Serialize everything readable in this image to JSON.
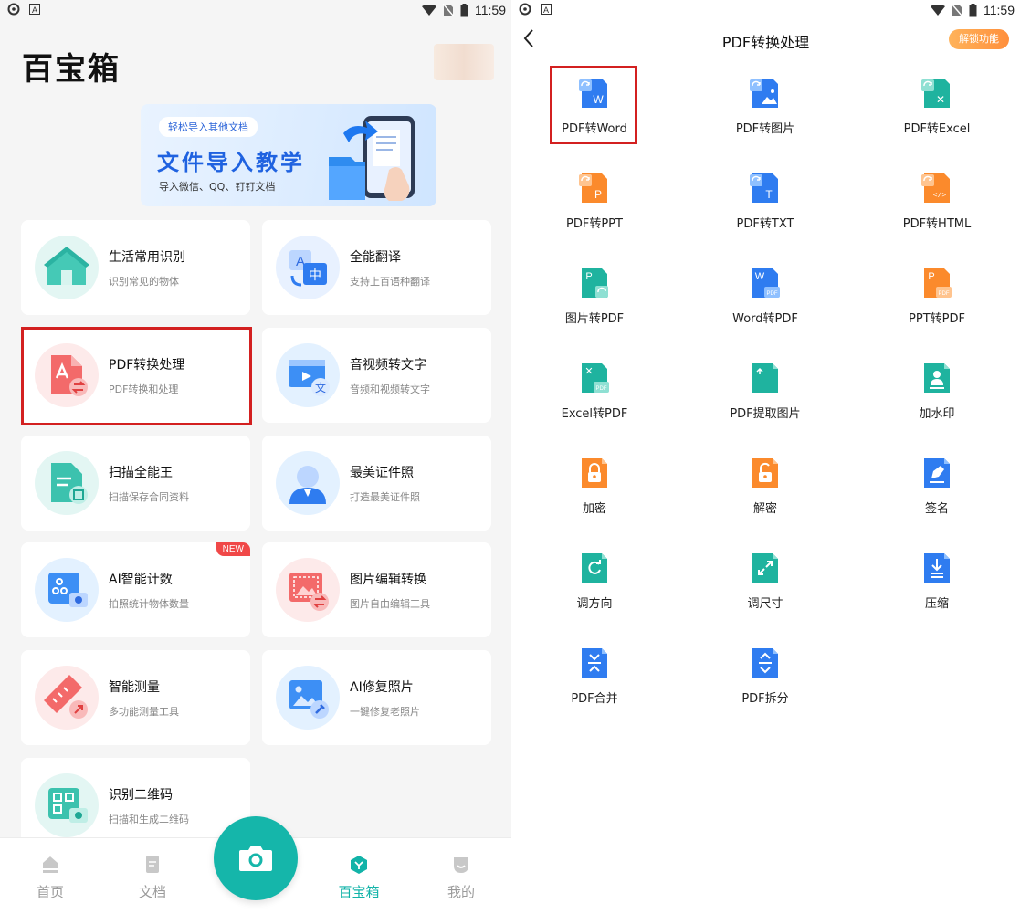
{
  "status_bar": {
    "time": "11:59"
  },
  "left": {
    "title": "百宝箱",
    "banner": {
      "tag": "轻松导入其他文档",
      "title": "文件导入教学",
      "subtitle": "导入微信、QQ、钉钉文档"
    },
    "cards": [
      {
        "title": "生活常用识别",
        "subtitle": "识别常见的物体",
        "icon": "house-icon"
      },
      {
        "title": "全能翻译",
        "subtitle": "支持上百语种翻译",
        "icon": "translate-icon"
      },
      {
        "title": "PDF转换处理",
        "subtitle": "PDF转换和处理",
        "icon": "pdf-convert-icon"
      },
      {
        "title": "音视频转文字",
        "subtitle": "音频和视频转文字",
        "icon": "video-text-icon"
      },
      {
        "title": "扫描全能王",
        "subtitle": "扫描保存合同资料",
        "icon": "scan-document-icon"
      },
      {
        "title": "最美证件照",
        "subtitle": "打造最美证件照",
        "icon": "id-photo-icon"
      },
      {
        "title": "AI智能计数",
        "subtitle": "拍照统计物体数量",
        "icon": "ai-count-icon",
        "badge": "NEW"
      },
      {
        "title": "图片编辑转换",
        "subtitle": "图片自由编辑工具",
        "icon": "image-edit-icon"
      },
      {
        "title": "智能测量",
        "subtitle": "多功能测量工具",
        "icon": "ruler-icon"
      },
      {
        "title": "AI修复照片",
        "subtitle": "一键修复老照片",
        "icon": "photo-repair-icon"
      },
      {
        "title": "识别二维码",
        "subtitle": "扫描和生成二维码",
        "icon": "qr-code-icon"
      }
    ],
    "nav": [
      {
        "label": "首页",
        "icon": "home-icon"
      },
      {
        "label": "文档",
        "icon": "document-icon"
      },
      {
        "label": "百宝箱",
        "icon": "toolbox-icon",
        "active": true
      },
      {
        "label": "我的",
        "icon": "profile-icon"
      }
    ]
  },
  "right": {
    "title": "PDF转换处理",
    "unlock_label": "解锁功能",
    "tools": [
      {
        "label": "PDF转Word",
        "icon": "pdf-to-word-icon"
      },
      {
        "label": "PDF转图片",
        "icon": "pdf-to-image-icon"
      },
      {
        "label": "PDF转Excel",
        "icon": "pdf-to-excel-icon"
      },
      {
        "label": "PDF转PPT",
        "icon": "pdf-to-ppt-icon"
      },
      {
        "label": "PDF转TXT",
        "icon": "pdf-to-txt-icon"
      },
      {
        "label": "PDF转HTML",
        "icon": "pdf-to-html-icon"
      },
      {
        "label": "图片转PDF",
        "icon": "image-to-pdf-icon"
      },
      {
        "label": "Word转PDF",
        "icon": "word-to-pdf-icon"
      },
      {
        "label": "PPT转PDF",
        "icon": "ppt-to-pdf-icon"
      },
      {
        "label": "Excel转PDF",
        "icon": "excel-to-pdf-icon"
      },
      {
        "label": "PDF提取图片",
        "icon": "pdf-extract-image-icon"
      },
      {
        "label": "加水印",
        "icon": "watermark-icon"
      },
      {
        "label": "加密",
        "icon": "encrypt-lock-icon"
      },
      {
        "label": "解密",
        "icon": "decrypt-unlock-icon"
      },
      {
        "label": "签名",
        "icon": "signature-icon"
      },
      {
        "label": "调方向",
        "icon": "rotate-icon"
      },
      {
        "label": "调尺寸",
        "icon": "resize-icon"
      },
      {
        "label": "压缩",
        "icon": "compress-icon"
      },
      {
        "label": "PDF合并",
        "icon": "merge-icon"
      },
      {
        "label": "PDF拆分",
        "icon": "split-icon"
      }
    ],
    "icon_letters": {
      "word": "W",
      "excel": "✕",
      "ppt": "P",
      "txt": "T",
      "html": "</>",
      "pdf_tag": "PDF"
    }
  },
  "colors": {
    "accent": "#15b6aa",
    "highlight": "#d32020",
    "unlock": "#ff9a45"
  }
}
